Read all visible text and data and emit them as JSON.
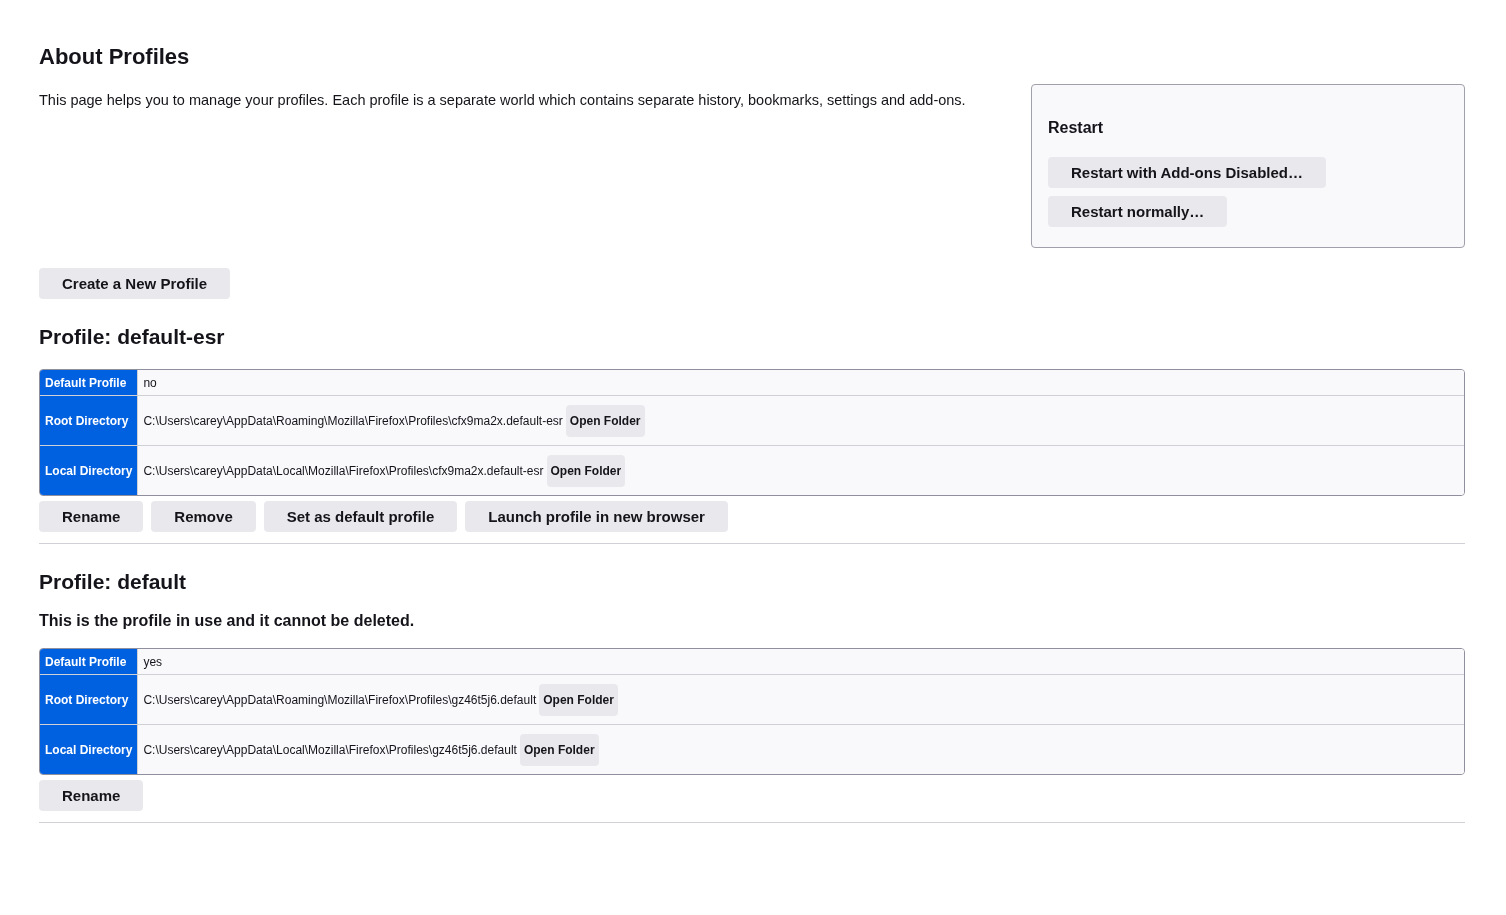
{
  "title": "About Profiles",
  "description": "This page helps you to manage your profiles. Each profile is a separate world which contains separate history, bookmarks, settings and add-ons.",
  "restart": {
    "title": "Restart",
    "buttons": [
      "Restart with Add-ons Disabled…",
      "Restart normally…"
    ]
  },
  "create_button": "Create a New Profile",
  "profiles": [
    {
      "title": "Profile: default-esr",
      "rows": [
        {
          "label": "Default Profile",
          "value": "no"
        },
        {
          "label": "Root Directory",
          "value": "C:\\Users\\carey\\AppData\\Roaming\\Mozilla\\Firefox\\Profiles\\cfx9ma2x.default-esr",
          "button": "Open Folder"
        },
        {
          "label": "Local Directory",
          "value": "C:\\Users\\carey\\AppData\\Local\\Mozilla\\Firefox\\Profiles\\cfx9ma2x.default-esr",
          "button": "Open Folder"
        }
      ],
      "buttons": [
        "Rename",
        "Remove",
        "Set as default profile",
        "Launch profile in new browser"
      ]
    },
    {
      "title": "Profile: default",
      "note": "This is the profile in use and it cannot be deleted.",
      "rows": [
        {
          "label": "Default Profile",
          "value": "yes"
        },
        {
          "label": "Root Directory",
          "value": "C:\\Users\\carey\\AppData\\Roaming\\Mozilla\\Firefox\\Profiles\\gz46t5j6.default",
          "button": "Open Folder"
        },
        {
          "label": "Local Directory",
          "value": "C:\\Users\\carey\\AppData\\Local\\Mozilla\\Firefox\\Profiles\\gz46t5j6.default",
          "button": "Open Folder"
        }
      ],
      "buttons": [
        "Rename"
      ]
    }
  ]
}
